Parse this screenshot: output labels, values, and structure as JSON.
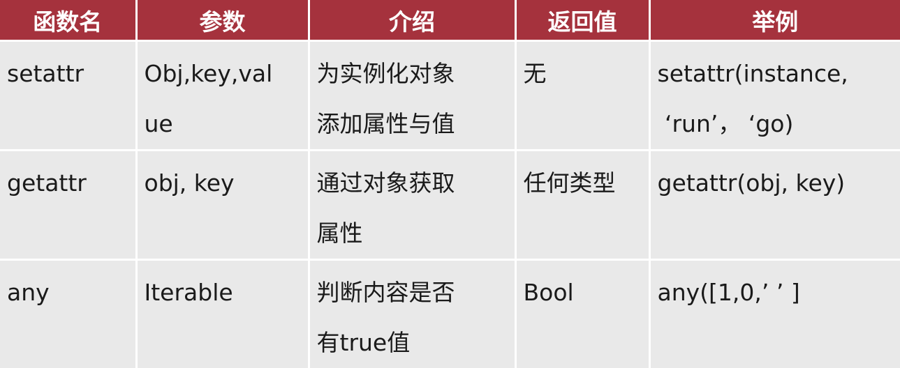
{
  "table": {
    "headers": [
      "函数名",
      "参数",
      "介绍",
      "返回值",
      "举例"
    ],
    "rows": [
      {
        "name": "setattr",
        "params": "Obj,key,val\nue",
        "description": "为实例化对象\n添加属性与值",
        "returns": "无",
        "example": "setattr(instance,\n ‘run’， ‘go)"
      },
      {
        "name": "getattr",
        "params": "obj, key",
        "description": "通过对象获取\n属性",
        "returns": "任何类型",
        "example": "getattr(obj, key)"
      },
      {
        "name": "any",
        "params": "Iterable",
        "description": "判断内容是否\n有true值",
        "returns": "Bool",
        "example": "any([1,0,’ ’ ]"
      }
    ]
  },
  "colors": {
    "header_bg": "#a5323d",
    "header_text": "#ffffff",
    "cell_bg": "#e9e9e9",
    "cell_text": "#1a1a1a",
    "grid_line": "#ffffff"
  }
}
